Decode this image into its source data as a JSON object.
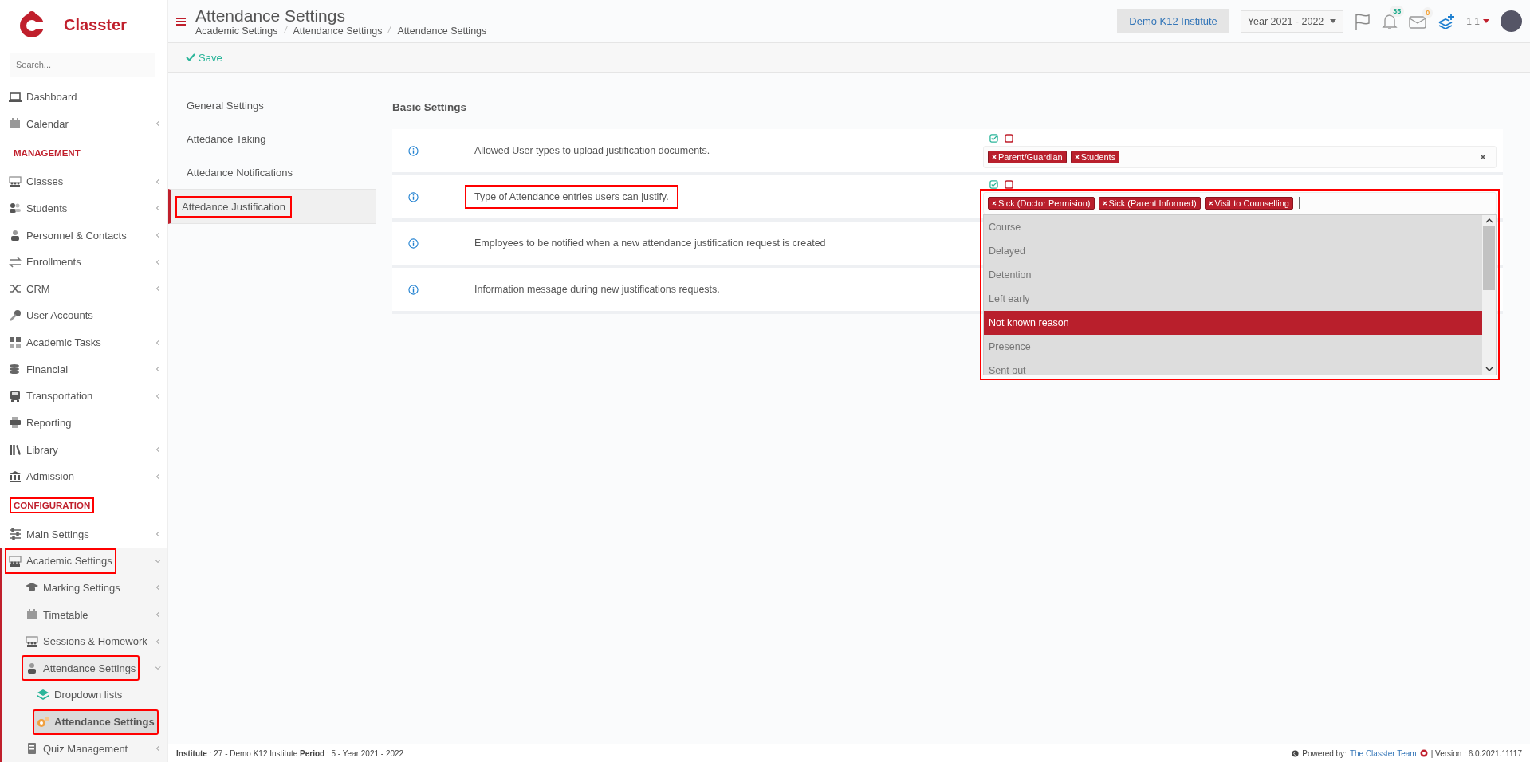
{
  "brand": {
    "name": "Classter"
  },
  "sidebar": {
    "search": {
      "placeholder": "Search..."
    },
    "items": [
      {
        "kind": "item",
        "label": "Dashboard",
        "submenu": false,
        "expanded": false,
        "selected": false,
        "annotated": false
      },
      {
        "kind": "item",
        "label": "Calendar",
        "submenu": true,
        "expanded": false,
        "selected": false,
        "annotated": false
      },
      {
        "kind": "heading",
        "label": "MANAGEMENT",
        "annotated": false
      },
      {
        "kind": "item",
        "label": "Classes",
        "submenu": true,
        "expanded": false,
        "selected": false,
        "annotated": false
      },
      {
        "kind": "item",
        "label": "Students",
        "submenu": true,
        "expanded": false,
        "selected": false,
        "annotated": false
      },
      {
        "kind": "item",
        "label": "Personnel & Contacts",
        "submenu": true,
        "expanded": false,
        "selected": false,
        "annotated": false
      },
      {
        "kind": "item",
        "label": "Enrollments",
        "submenu": true,
        "expanded": false,
        "selected": false,
        "annotated": false
      },
      {
        "kind": "item",
        "label": "CRM",
        "submenu": true,
        "expanded": false,
        "selected": false,
        "annotated": false
      },
      {
        "kind": "item",
        "label": "User Accounts",
        "submenu": false,
        "expanded": false,
        "selected": false,
        "annotated": false
      },
      {
        "kind": "item",
        "label": "Academic Tasks",
        "submenu": true,
        "expanded": false,
        "selected": false,
        "annotated": false
      },
      {
        "kind": "item",
        "label": "Financial",
        "submenu": true,
        "expanded": false,
        "selected": false,
        "annotated": false
      },
      {
        "kind": "item",
        "label": "Transportation",
        "submenu": true,
        "expanded": false,
        "selected": false,
        "annotated": false
      },
      {
        "kind": "item",
        "label": "Reporting",
        "submenu": false,
        "expanded": false,
        "selected": false,
        "annotated": false
      },
      {
        "kind": "item",
        "label": "Library",
        "submenu": true,
        "expanded": false,
        "selected": false,
        "annotated": false
      },
      {
        "kind": "item",
        "label": "Admission",
        "submenu": true,
        "expanded": false,
        "selected": false,
        "annotated": false
      },
      {
        "kind": "heading",
        "label": "CONFIGURATION",
        "annotated": true
      },
      {
        "kind": "item",
        "label": "Main Settings",
        "submenu": true,
        "expanded": false,
        "selected": false,
        "annotated": false
      },
      {
        "kind": "item",
        "label": "Academic Settings",
        "submenu": true,
        "expanded": true,
        "selected": false,
        "annotated": true,
        "children": [
          {
            "kind": "item",
            "label": "Marking Settings",
            "submenu": true,
            "expanded": false,
            "selected": false,
            "annotated": false
          },
          {
            "kind": "item",
            "label": "Timetable",
            "submenu": true,
            "expanded": false,
            "selected": false,
            "annotated": false
          },
          {
            "kind": "item",
            "label": "Sessions & Homework",
            "submenu": true,
            "expanded": false,
            "selected": false,
            "annotated": false
          },
          {
            "kind": "item",
            "label": "Attendance Settings",
            "submenu": true,
            "expanded": true,
            "selected": false,
            "annotated": true,
            "children": [
              {
                "kind": "item",
                "label": "Dropdown lists",
                "submenu": false,
                "expanded": false,
                "selected": false,
                "annotated": false
              },
              {
                "kind": "item",
                "label": "Attendance Settings",
                "submenu": false,
                "expanded": false,
                "selected": true,
                "annotated": true
              }
            ]
          },
          {
            "kind": "item",
            "label": "Quiz Management",
            "submenu": true,
            "expanded": false,
            "selected": false,
            "annotated": false
          }
        ]
      }
    ]
  },
  "header": {
    "title": "Attendance Settings",
    "breadcrumbs": [
      "Academic Settings",
      "Attendance Settings",
      "Attendance Settings"
    ],
    "institute": "Demo K12 Institute",
    "year": "Year 2021 - 2022",
    "notifications": "35",
    "messages": "0",
    "user": "1 1"
  },
  "toolbar": {
    "save": "Save"
  },
  "settings_nav": [
    {
      "label": "General Settings",
      "selected": false,
      "annotated": false
    },
    {
      "label": "Attedance Taking",
      "selected": false,
      "annotated": false
    },
    {
      "label": "Attedance Notifications",
      "selected": false,
      "annotated": false
    },
    {
      "label": "Attedance Justification",
      "selected": true,
      "annotated": true
    }
  ],
  "section_title": "Basic Settings",
  "settings": [
    {
      "label": "Allowed User types to upload justification documents.",
      "annotated": false,
      "control": {
        "annotated": false,
        "tags": [
          "Parent/Guardian",
          "Students"
        ],
        "clearable": true,
        "open": false
      }
    },
    {
      "label": "Type of Attendance entries users can justify.",
      "annotated": true,
      "control": {
        "annotated": true,
        "tags": [
          "Sick (Doctor Permision)",
          "Sick (Parent Informed)",
          "Visit to Counselling"
        ],
        "clearable": false,
        "open": true,
        "options": [
          {
            "label": "Course",
            "highlighted": false
          },
          {
            "label": "Delayed",
            "highlighted": false
          },
          {
            "label": "Detention",
            "highlighted": false
          },
          {
            "label": "Left early",
            "highlighted": false
          },
          {
            "label": "Not known reason",
            "highlighted": true
          },
          {
            "label": "Presence",
            "highlighted": false
          },
          {
            "label": "Sent out",
            "highlighted": false
          }
        ]
      }
    },
    {
      "label": "Employees to be notified when a new attendance justification request is created",
      "annotated": false
    },
    {
      "label": "Information message during new justifications requests.",
      "annotated": false
    }
  ],
  "footer": {
    "info": "**Institute** : 27 - Demo K12 Institute **Period** : 5 - Year 2021 - 2022",
    "powered": "Powered by:",
    "team": "The Classter Team",
    "version": "| Version : 6.0.2021.11117"
  }
}
